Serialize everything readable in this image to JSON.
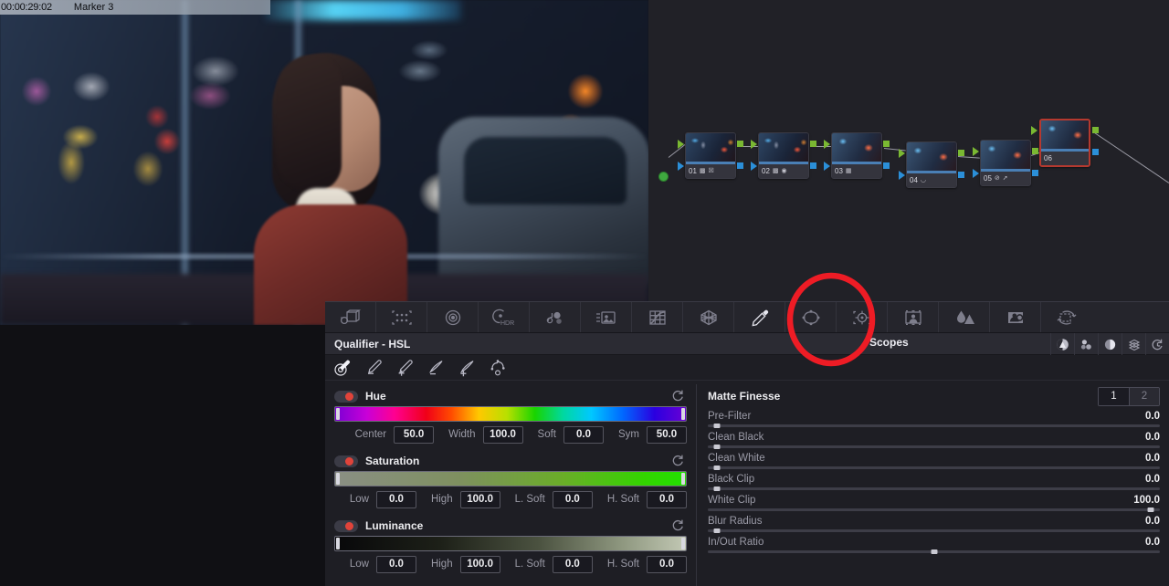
{
  "viewer": {
    "timecode": "00:00:29:02",
    "marker_label": "Marker 3",
    "scene_description": "Blurred night city street with neon bokeh and a woman in a red coat"
  },
  "node_graph": {
    "nodes": [
      {
        "number": "01",
        "badges": [
          "histogram-icon",
          "checkbox-icon"
        ],
        "selected": false
      },
      {
        "number": "02",
        "badges": [
          "histogram-icon",
          "circle-icon"
        ],
        "selected": false
      },
      {
        "number": "03",
        "badges": [
          "grid-icon"
        ],
        "selected": false
      },
      {
        "number": "04",
        "badges": [
          "blur-icon"
        ],
        "selected": false
      },
      {
        "number": "05",
        "badges": [
          "no-icon",
          "eyedropper-icon"
        ],
        "selected": false
      },
      {
        "number": "06",
        "badges": [],
        "selected": true
      }
    ]
  },
  "toolbar": {
    "items": [
      {
        "name": "camera-raw-icon",
        "label": "Camera Raw",
        "active": false
      },
      {
        "name": "color-match-icon",
        "label": "Color Match",
        "active": false
      },
      {
        "name": "color-wheels-icon",
        "label": "Color Wheels",
        "active": false
      },
      {
        "name": "hdr-wheels-icon",
        "label": "HDR Wheels",
        "active": false
      },
      {
        "name": "rgb-mixer-icon",
        "label": "RGB Mixer",
        "active": false
      },
      {
        "name": "motion-effects-icon",
        "label": "Motion Effects",
        "active": false
      },
      {
        "name": "curves-icon",
        "label": "Curves",
        "active": false
      },
      {
        "name": "color-warper-icon",
        "label": "Color Warper",
        "active": false
      },
      {
        "name": "qualifier-icon",
        "label": "Qualifier",
        "active": true
      },
      {
        "name": "power-window-icon",
        "label": "Power Windows",
        "active": false
      },
      {
        "name": "tracker-icon",
        "label": "Tracker",
        "active": false
      },
      {
        "name": "magic-mask-icon",
        "label": "Magic Mask",
        "active": false
      },
      {
        "name": "blur-icon",
        "label": "Blur",
        "active": false
      },
      {
        "name": "key-icon",
        "label": "Key",
        "active": false
      },
      {
        "name": "sizing-icon",
        "label": "Sizing",
        "active": false
      }
    ]
  },
  "panel": {
    "title": "Qualifier - HSL",
    "header_tools": [
      {
        "name": "highlight-icon",
        "label": "Highlight"
      },
      {
        "name": "colorspace-icon",
        "label": "Color Space"
      },
      {
        "name": "invert-icon",
        "label": "Invert"
      },
      {
        "name": "mesh-icon",
        "label": "3D Mesh"
      },
      {
        "name": "reset-icon",
        "label": "Reset"
      }
    ],
    "picker_tools": [
      {
        "name": "picker-icon",
        "label": "Pick",
        "active": true
      },
      {
        "name": "picker-minus-icon",
        "label": "Pick Subtract",
        "active": false
      },
      {
        "name": "picker-plus-icon",
        "label": "Pick Add",
        "active": false
      },
      {
        "name": "softness-minus-icon",
        "label": "Softness Subtract",
        "active": false
      },
      {
        "name": "softness-plus-icon",
        "label": "Softness Add",
        "active": false
      },
      {
        "name": "invert-selection-icon",
        "label": "Invert Selection",
        "active": false
      }
    ],
    "scopes_label": "Scopes"
  },
  "qualifier": {
    "groups": [
      {
        "name": "Hue",
        "enabled": true,
        "gradient": "hue",
        "fields": [
          {
            "label": "Center",
            "value": "50.0"
          },
          {
            "label": "Width",
            "value": "100.0"
          },
          {
            "label": "Soft",
            "value": "0.0"
          },
          {
            "label": "Sym",
            "value": "50.0"
          }
        ]
      },
      {
        "name": "Saturation",
        "enabled": true,
        "gradient": "sat",
        "fields": [
          {
            "label": "Low",
            "value": "0.0"
          },
          {
            "label": "High",
            "value": "100.0"
          },
          {
            "label": "L. Soft",
            "value": "0.0"
          },
          {
            "label": "H. Soft",
            "value": "0.0"
          }
        ]
      },
      {
        "name": "Luminance",
        "enabled": true,
        "gradient": "lum",
        "fields": [
          {
            "label": "Low",
            "value": "0.0"
          },
          {
            "label": "High",
            "value": "100.0"
          },
          {
            "label": "L. Soft",
            "value": "0.0"
          },
          {
            "label": "H. Soft",
            "value": "0.0"
          }
        ]
      }
    ]
  },
  "matte_finesse": {
    "title": "Matte Finesse",
    "tabs": [
      {
        "label": "1",
        "selected": true
      },
      {
        "label": "2",
        "selected": false
      }
    ],
    "params": [
      {
        "label": "Pre-Filter",
        "value": "0.0",
        "knob_pct": 2
      },
      {
        "label": "Clean Black",
        "value": "0.0",
        "knob_pct": 2
      },
      {
        "label": "Clean White",
        "value": "0.0",
        "knob_pct": 2
      },
      {
        "label": "Black Clip",
        "value": "0.0",
        "knob_pct": 2
      },
      {
        "label": "White Clip",
        "value": "100.0",
        "knob_pct": 98
      },
      {
        "label": "Blur Radius",
        "value": "0.0",
        "knob_pct": 2
      },
      {
        "label": "In/Out Ratio",
        "value": "0.0",
        "knob_pct": 50
      }
    ]
  },
  "annotation": {
    "shape": "ellipse",
    "color": "#ee1c25",
    "target": "power-window-icon"
  },
  "colors": {
    "panel_bg": "#1e1e24",
    "toolbar_bg": "#25252c",
    "node_bg": "#212127",
    "accent_red": "#e0433a",
    "port_green": "#7ab832",
    "port_blue": "#2b8fd8",
    "annotation_red": "#ee1c25"
  }
}
